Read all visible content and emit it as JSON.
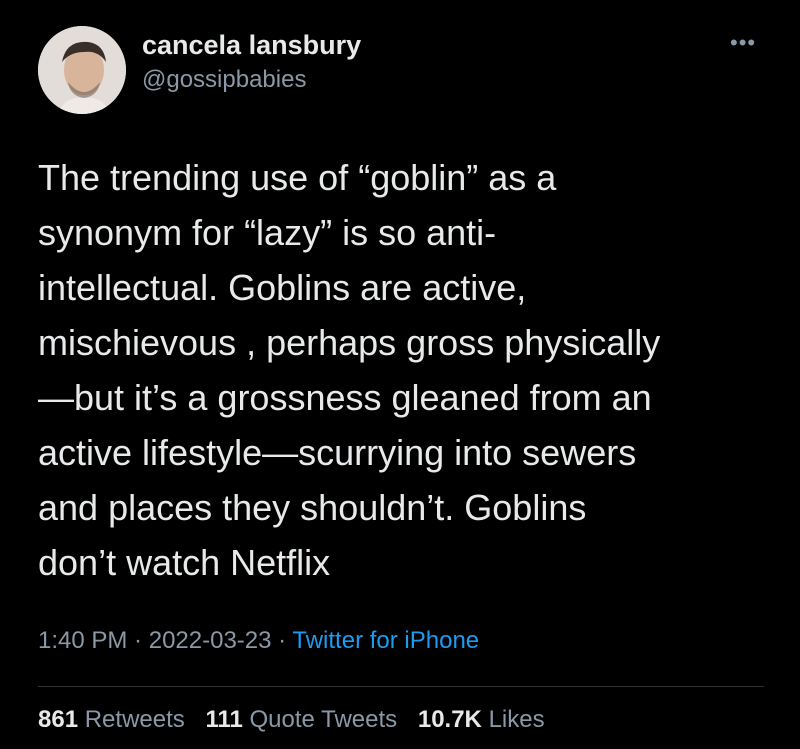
{
  "author": {
    "display_name": "cancela lansbury",
    "handle": "@gossipbabies",
    "avatar_icon": "profile-photo"
  },
  "menu_icon": "more-horizontal-icon",
  "tweet": {
    "lines": [
      "The trending use of “goblin” as a",
      "synonym for “lazy” is so anti-",
      "intellectual. Goblins are active,",
      "mischievous , perhaps gross physically",
      "—but it’s a grossness gleaned from an",
      "active lifestyle—scurrying into sewers",
      "and places they shouldn’t. Goblins",
      "don’t watch Netflix"
    ]
  },
  "meta": {
    "time": "1:40 PM",
    "sep1": " · ",
    "date": "2022-03-23",
    "sep2": " · ",
    "source": "Twitter for iPhone"
  },
  "stats": {
    "retweets_count": "861",
    "retweets_label": "Retweets",
    "quotes_count": "111",
    "quotes_label": "Quote Tweets",
    "likes_count": "10.7K",
    "likes_label": "Likes"
  },
  "colors": {
    "background": "#000000",
    "text": "#e7e9ea",
    "secondary": "#8b98a5",
    "link": "#1d9bf0"
  }
}
